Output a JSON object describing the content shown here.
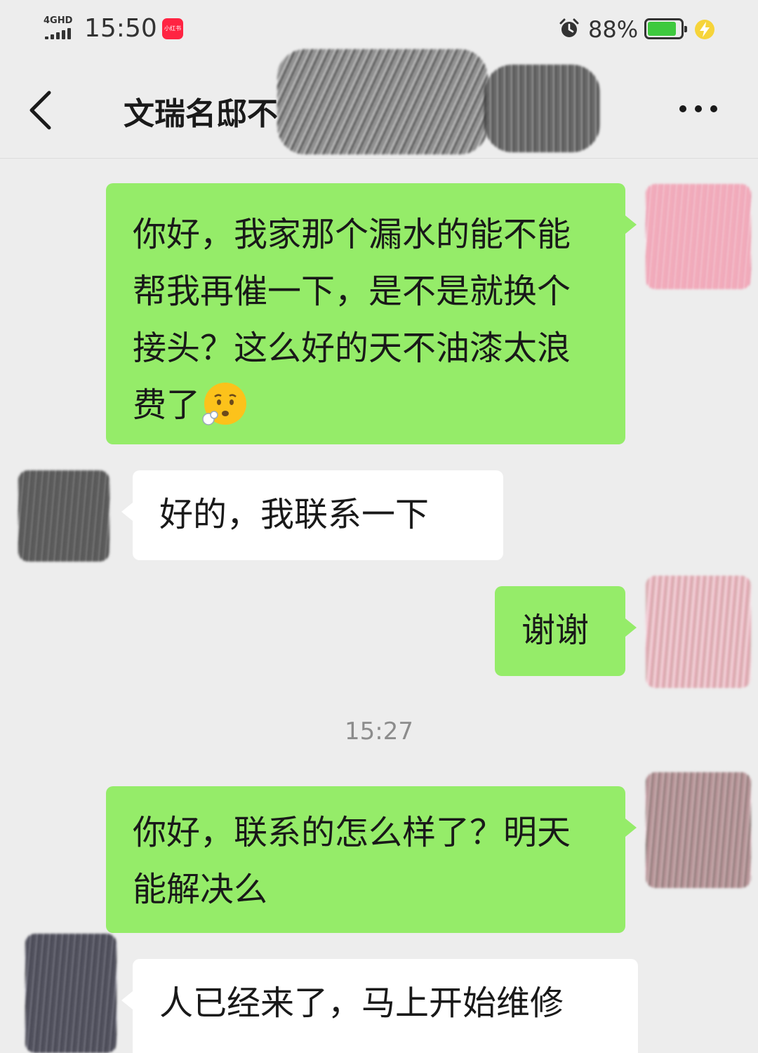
{
  "status_bar": {
    "network": "4GHD",
    "time": "15:50",
    "app_badge": "小红书",
    "battery_percent": "88%",
    "battery_level": 0.88,
    "icons": [
      "signal-icon",
      "alarm-icon",
      "battery-icon",
      "charging-icon"
    ]
  },
  "header": {
    "title": "文瑞名邸不",
    "back_icon": "chevron-left-icon",
    "more_icon": "more-dots-icon"
  },
  "messages": [
    {
      "side": "sent",
      "text": "你好，我家那个漏水的能不能帮我再催一下，是不是就换个接头？这么好的天不油漆太浪费了",
      "emoji": "sad-face-exhaling-emoji"
    },
    {
      "side": "received",
      "text": "好的，我联系一下"
    },
    {
      "side": "sent",
      "text": "谢谢"
    },
    {
      "side": "sent",
      "text": "你好，联系的怎么样了？明天能解决么"
    },
    {
      "side": "received",
      "text": "人已经来了，马上开始维修"
    }
  ],
  "timestamp": "15:27",
  "colors": {
    "background": "#ededed",
    "sent_bubble": "#95ec69",
    "received_bubble": "#ffffff",
    "timestamp_text": "#8c8c8c"
  }
}
